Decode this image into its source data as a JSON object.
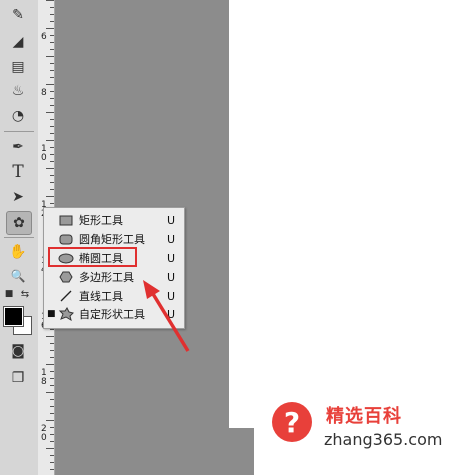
{
  "ruler_labels": [
    "6",
    "8",
    "1\n0",
    "1\n2",
    "1\n4",
    "1\n6",
    "1\n8",
    "2\n0"
  ],
  "tools": [
    {
      "name": "brush-icon",
      "glyph": "✎"
    },
    {
      "name": "eraser-icon",
      "glyph": "◢"
    },
    {
      "name": "gradient-icon",
      "glyph": "▤"
    },
    {
      "name": "blur-icon",
      "glyph": "♨"
    },
    {
      "name": "dodge-icon",
      "glyph": "◔"
    },
    {
      "name": "pen-icon",
      "glyph": "✒"
    },
    {
      "name": "type-icon",
      "glyph": "T"
    },
    {
      "name": "path-select-icon",
      "glyph": "➤"
    },
    {
      "name": "shape-tool-icon",
      "glyph": "✿"
    },
    {
      "name": "hand-icon",
      "glyph": "✋"
    },
    {
      "name": "zoom-icon",
      "glyph": "🔍"
    },
    {
      "name": "quick-mask-icon",
      "glyph": "◙"
    },
    {
      "name": "screen-mode-icon",
      "glyph": "❐"
    }
  ],
  "flyout": {
    "items": [
      {
        "label": "矩形工具",
        "key": "U",
        "icon": "rectangle-icon",
        "selected": false
      },
      {
        "label": "圆角矩形工具",
        "key": "U",
        "icon": "rounded-rectangle-icon",
        "selected": false
      },
      {
        "label": "椭圆工具",
        "key": "U",
        "icon": "ellipse-icon",
        "selected": false
      },
      {
        "label": "多边形工具",
        "key": "U",
        "icon": "polygon-icon",
        "selected": false
      },
      {
        "label": "直线工具",
        "key": "U",
        "icon": "line-icon",
        "selected": false
      },
      {
        "label": "自定形状工具",
        "key": "U",
        "icon": "custom-shape-icon",
        "selected": true
      }
    ]
  },
  "annotation": {
    "highlight_color": "#e03030"
  },
  "watermark": {
    "title": "精选百科",
    "url": "zhang365.com",
    "logo_glyph": "?",
    "color": "#e8403a"
  }
}
